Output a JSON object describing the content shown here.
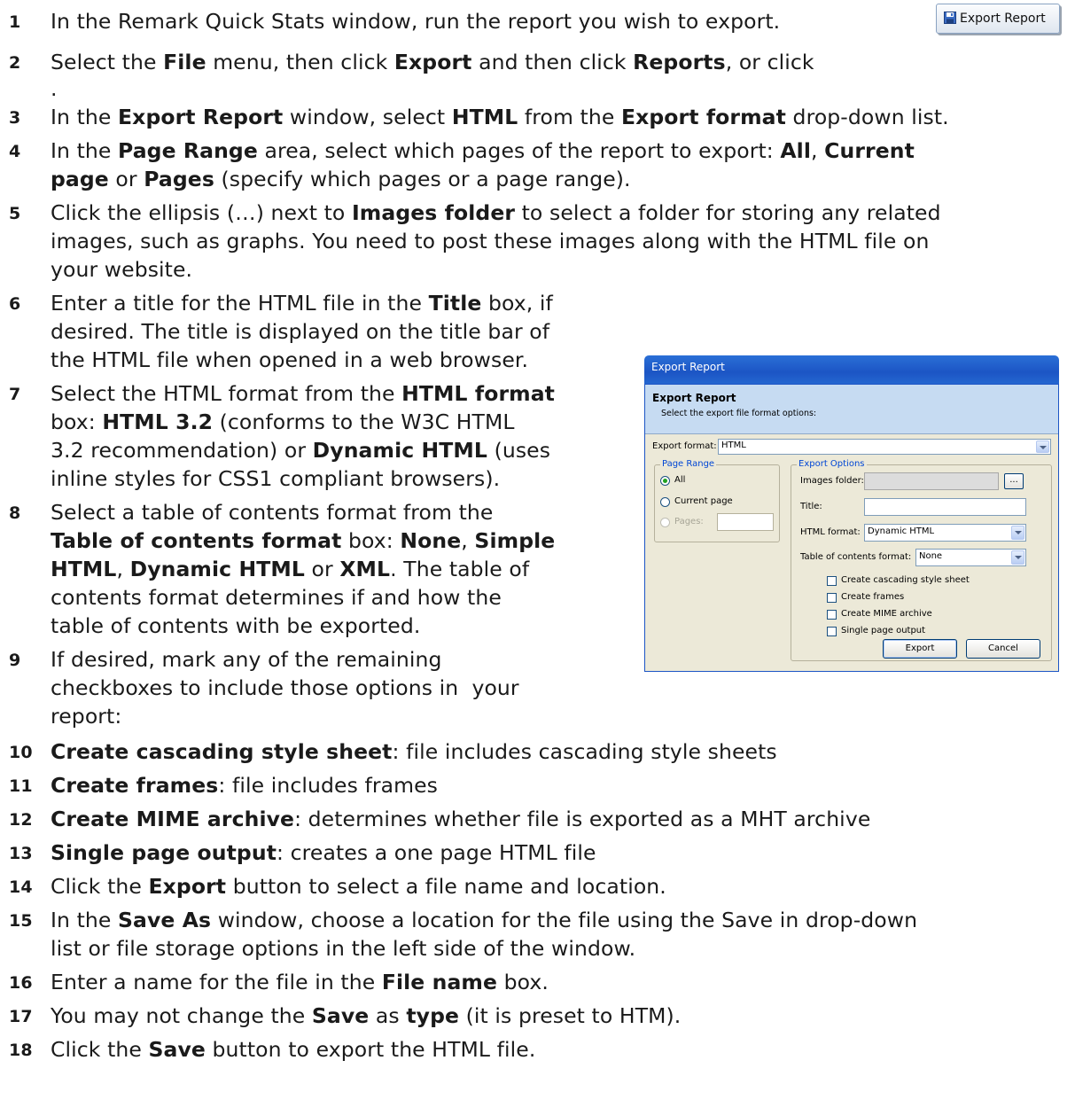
{
  "steps": [
    {
      "n": "1",
      "html": "In the Remark Quick Stats window, run the report you wish to export."
    },
    {
      "n": "2",
      "html": "Select the <b>File</b> menu, then click <b>Export</b> and then click <b>Reports</b>, or click"
    },
    {
      "n": "",
      "html": "."
    },
    {
      "n": "3",
      "html": "In the <b>Export Report</b> window, select <b>HTML</b> from the <b>Export format</b> drop-down list."
    },
    {
      "n": "4",
      "html": "In the <b>Page Range</b> area, select which pages of the report to export: <b>All</b>, <b>Current</b>"
    },
    {
      "n": "",
      "html": "<b>page</b> or <b>Pages</b> (specify which pages or a page range)."
    },
    {
      "n": "5",
      "html": "Click the ellipsis (…) next to <b>Images folder</b> to select a folder for storing any related"
    },
    {
      "n": "",
      "html": "images, such as graphs. You need to post these images along with the HTML file on"
    },
    {
      "n": "",
      "html": "your website."
    },
    {
      "n": "6",
      "html": "Enter a title for the HTML file in the <b>Title</b> box, if"
    },
    {
      "n": "",
      "html": "desired. The title is displayed on the title bar of"
    },
    {
      "n": "",
      "html": "the HTML file when opened in a web browser."
    },
    {
      "n": "7",
      "html": "Select the HTML format from the <b>HTML format</b>"
    },
    {
      "n": "",
      "html": "box: <b>HTML 3.2</b> (conforms to the W3C HTML"
    },
    {
      "n": "",
      "html": "3.2 recommendation) or <b>Dynamic HTML</b> (uses"
    },
    {
      "n": "",
      "html": "inline styles for CSS1 compliant browsers)."
    },
    {
      "n": "8",
      "html": "Select a table of contents format from the"
    },
    {
      "n": "",
      "html": "<b>Table of contents format</b> box: <b>None</b>, <b>Simple</b>"
    },
    {
      "n": "",
      "html": "<b>HTML</b>, <b>Dynamic HTML</b> or <b>XML</b>. The table of"
    },
    {
      "n": "",
      "html": "contents format determines if and how the"
    },
    {
      "n": "",
      "html": "table of contents with be exported."
    },
    {
      "n": "9",
      "html": "If desired, mark any of the remaining"
    },
    {
      "n": "",
      "html": "checkboxes to include those options in &nbsp;your"
    },
    {
      "n": "",
      "html": "report:"
    },
    {
      "n": "10",
      "html": "<b>Create cascading style sheet</b>: file includes cascading style sheets"
    },
    {
      "n": "11",
      "html": "<b>Create frames</b>: file includes frames"
    },
    {
      "n": "12",
      "html": "<b>Create MIME archive</b>: determines whether file is exported as a MHT archive"
    },
    {
      "n": "13",
      "html": "<b>Single page output</b>: creates a one page HTML file"
    },
    {
      "n": "14",
      "html": "Click the <b>Export</b> button to select a file name and location."
    },
    {
      "n": "15",
      "html": "In the <b>Save As</b> window, choose a location for the file using the Save in drop-down"
    },
    {
      "n": "",
      "html": "list or file storage options in the left side of the window."
    },
    {
      "n": "16",
      "html": "Enter a name for the file in the <b>File name</b> box."
    },
    {
      "n": "17",
      "html": "You may not change the <b>Save</b> as <b>type</b> (it is preset to HTM)."
    },
    {
      "n": "18",
      "html": "Click the <b>Save</b> button to export the HTML file."
    }
  ],
  "toolbar_button": {
    "label": "Export Report",
    "icon": "floppy-disk-icon"
  },
  "dialog": {
    "title": "Export Report",
    "header_title": "Export Report",
    "header_subtitle": "Select the export file format options:",
    "export_format_label": "Export format:",
    "export_format_value": "HTML",
    "page_range": {
      "title": "Page Range",
      "all": "All",
      "current": "Current page",
      "pages": "Pages:",
      "selected": "All"
    },
    "export_options": {
      "title": "Export Options",
      "images_folder_label": "Images folder:",
      "ellipsis": "...",
      "title_label": "Title:",
      "html_format_label": "HTML format:",
      "html_format_value": "Dynamic HTML",
      "toc_label": "Table of contents format:",
      "toc_value": "None",
      "checkboxes": [
        "Create cascading style sheet",
        "Create frames",
        "Create MIME archive",
        "Single page output"
      ]
    },
    "buttons": {
      "export": "Export",
      "cancel": "Cancel"
    },
    "colors": {
      "titlebar": "#1c55c5",
      "header_band": "#c6dbf2",
      "body": "#ece9d8",
      "group_title": "#0046d5"
    }
  }
}
